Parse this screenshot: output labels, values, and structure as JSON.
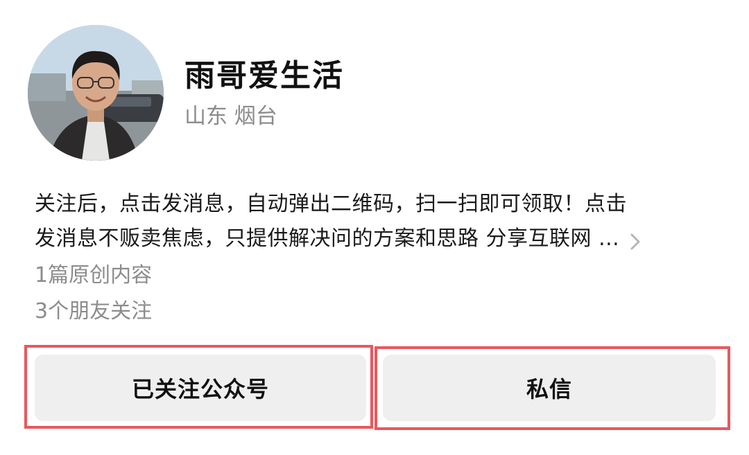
{
  "profile": {
    "name": "雨哥爱生活",
    "location": "山东 烟台",
    "bio_line1": "关注后，点击发消息，自动弹出二维码，扫一扫即可领取！点击",
    "bio_line2": "发消息不贩卖焦虑，只提供解决问的方案和思路 分享互联网 ...",
    "original_count": "1篇原创内容",
    "friends_following": "3个朋友关注"
  },
  "actions": {
    "follow_label": "已关注公众号",
    "message_label": "私信"
  },
  "icons": {
    "expand": "chevron-right-icon"
  },
  "colors": {
    "highlight_outline": "#e8585e",
    "button_bg": "#efefef",
    "secondary_text": "#8c8c8c"
  }
}
